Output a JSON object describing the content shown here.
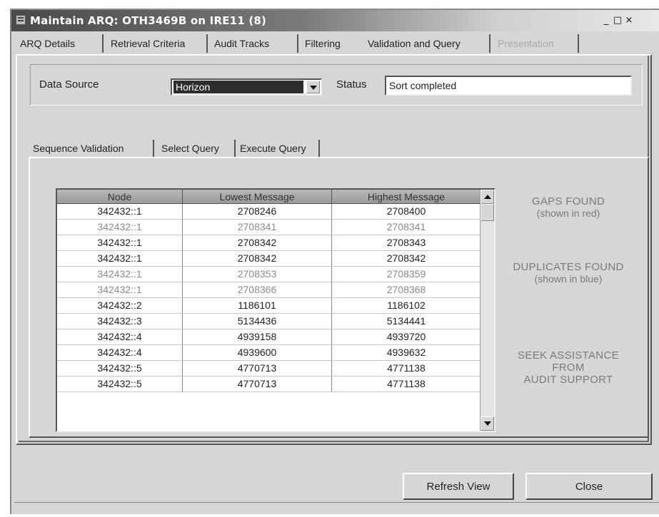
{
  "window": {
    "title": "Maintain ARQ: OTH3469B  on  IRE11 (8)",
    "controls": [
      "_",
      "□",
      "×"
    ]
  },
  "tabs": [
    {
      "label": "ARQ Details"
    },
    {
      "label": "Retrieval Criteria"
    },
    {
      "label": "Audit Tracks"
    },
    {
      "label": "Filtering"
    },
    {
      "label": "Validation and Query"
    },
    {
      "label": "Presentation"
    }
  ],
  "data_source": {
    "label": "Data Source",
    "selected": "Horizon",
    "status_label": "Status",
    "status_value": "Sort completed"
  },
  "subtabs": [
    {
      "label": "Sequence Validation"
    },
    {
      "label": "Select Query"
    },
    {
      "label": "Execute Query"
    }
  ],
  "grid": {
    "columns": [
      "Node",
      "Lowest Message",
      "Highest Message"
    ],
    "rows": [
      {
        "node": "342432::1",
        "low": "2708246",
        "high": "2708400",
        "status": "normal"
      },
      {
        "node": "342432::1",
        "low": "2708341",
        "high": "2708341",
        "status": "gap"
      },
      {
        "node": "342432::1",
        "low": "2708342",
        "high": "2708343",
        "status": "normal"
      },
      {
        "node": "342432::1",
        "low": "2708342",
        "high": "2708342",
        "status": "normal"
      },
      {
        "node": "342432::1",
        "low": "2708353",
        "high": "2708359",
        "status": "gap"
      },
      {
        "node": "342432::1",
        "low": "2708366",
        "high": "2708368",
        "status": "gap"
      },
      {
        "node": "342432::2",
        "low": "1186101",
        "high": "1186102",
        "status": "normal"
      },
      {
        "node": "342432::3",
        "low": "5134436",
        "high": "5134441",
        "status": "normal"
      },
      {
        "node": "342432::4",
        "low": "4939158",
        "high": "4939720",
        "status": "normal"
      },
      {
        "node": "342432::4",
        "low": "4939600",
        "high": "4939632",
        "status": "normal"
      },
      {
        "node": "342432::5",
        "low": "4770713",
        "high": "4771138",
        "status": "normal"
      },
      {
        "node": "342432::5",
        "low": "4770713",
        "high": "4771138",
        "status": "normal"
      }
    ]
  },
  "notes": {
    "gaps_title": "GAPS FOUND",
    "gaps_sub": "(shown in red)",
    "dups_title": "DUPLICATES FOUND",
    "dups_sub": "(shown in blue)",
    "seek_1": "SEEK ASSISTANCE",
    "seek_2": "FROM",
    "seek_3": "AUDIT SUPPORT"
  },
  "buttons": {
    "refresh": "Refresh View",
    "close": "Close"
  }
}
